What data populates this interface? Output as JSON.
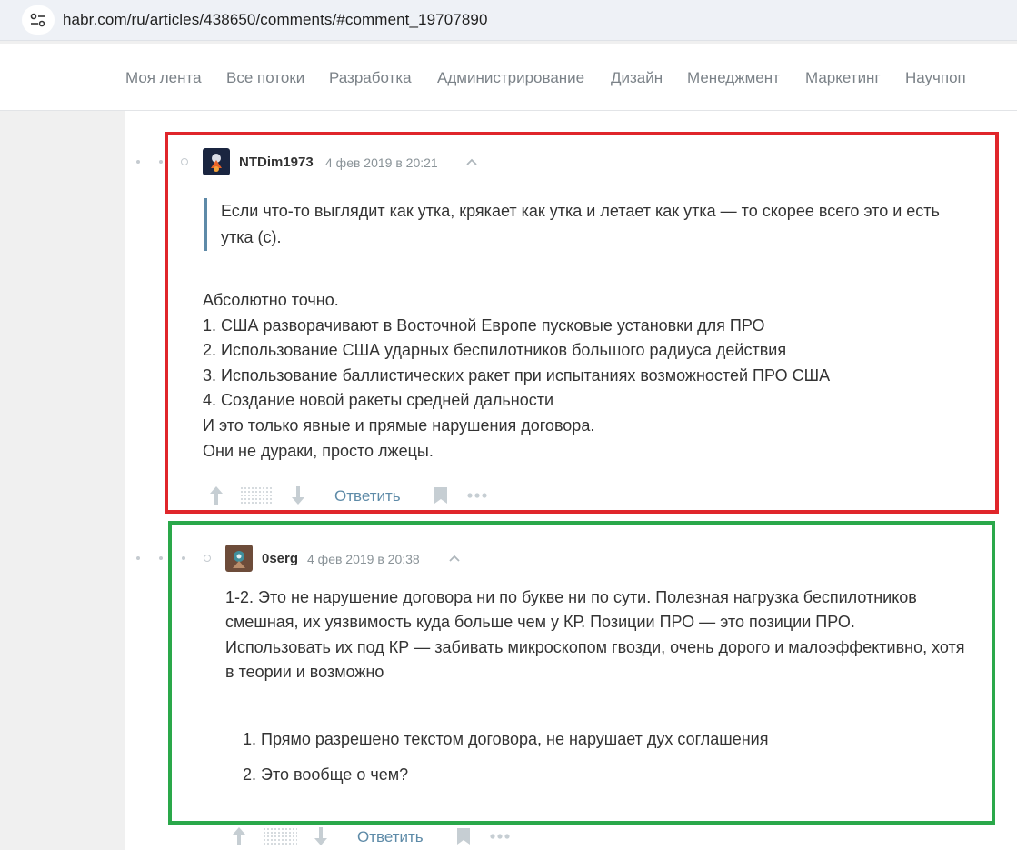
{
  "browser": {
    "url": "habr.com/ru/articles/438650/comments/#comment_19707890"
  },
  "nav": {
    "items": [
      "Моя лента",
      "Все потоки",
      "Разработка",
      "Администрирование",
      "Дизайн",
      "Менеджмент",
      "Маркетинг",
      "Научпоп"
    ]
  },
  "comments": [
    {
      "author": "NTDim1973",
      "date": "4 фев 2019 в 20:21",
      "quote_lines": [
        "Если что-то выглядит как утка, крякает как утка и летает как утка — то скорее всего это и есть",
        "утка (с)."
      ],
      "body_lines": [
        "Абсолютно точно.",
        "1. США разворачивают в Восточной Европе пусковые установки для ПРО",
        "2. Использование США ударных беспилотников большого радиуса действия",
        "3. Использование баллистических ракет при испытаниях возможностей ПРО США",
        "4. Создание новой ракеты средней дальности",
        "И это только явные и прямые нарушения договора.",
        "Они не дураки, просто лжецы."
      ],
      "reply_label": "Ответить"
    },
    {
      "author": "0serg",
      "date": "4 фев 2019 в 20:38",
      "body_lines": [
        "1-2. Это не нарушение договора ни по букве ни по сути. Полезная нагрузка беспилотников",
        "смешная, их уязвимость куда больше чем у КР. Позиции ПРО — это позиции ПРО.",
        "Использовать их под КР — забивать микроскопом гвозди, очень дорого и малоэффективно, хотя",
        "в теории и возможно"
      ],
      "list": [
        "1. Прямо разрешено текстом договора, не нарушает дух соглашения",
        "2. Это вообще о чем?"
      ],
      "reply_label": "Ответить"
    }
  ],
  "icons": {
    "site_settings": "tune-icon",
    "upvote": "arrow-up-icon",
    "downvote": "arrow-down-icon",
    "bookmark": "bookmark-icon",
    "more": "more-horizontal-icon",
    "collapse": "chevron-up-icon"
  },
  "colors": {
    "link": "#5e8ba8",
    "highlight_red": "#e0262b",
    "highlight_green": "#2aa84a",
    "quote_border": "#5e8aa8"
  }
}
